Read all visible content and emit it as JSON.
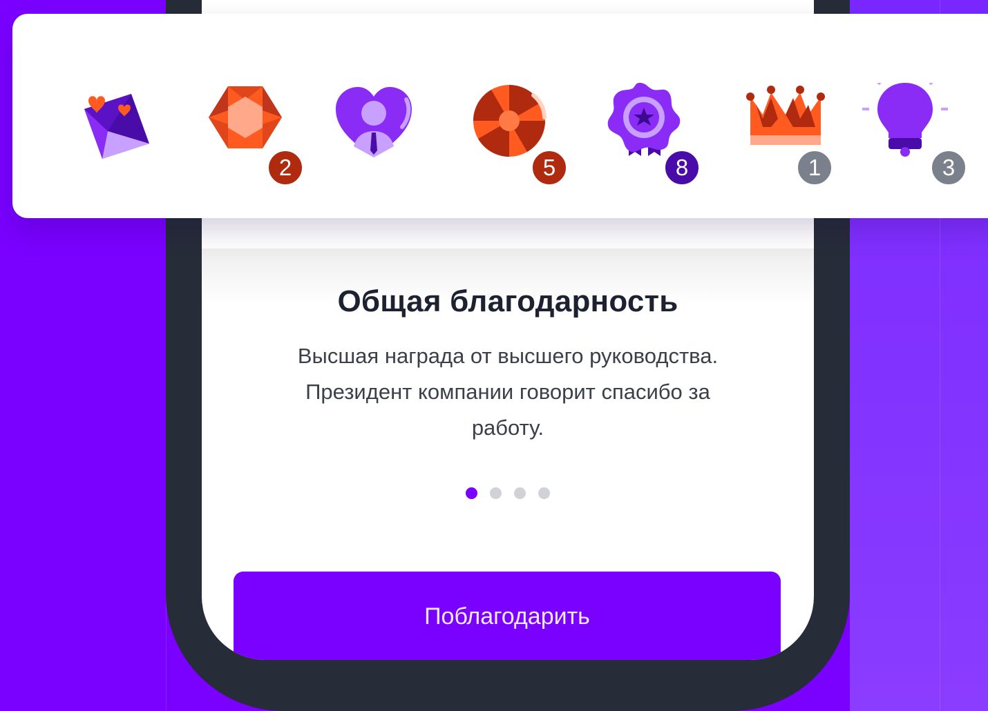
{
  "colors": {
    "brand": "#7a00ff",
    "badge_red": "#b02a10",
    "badge_purple": "#4a0ca8",
    "badge_gray": "#7b818c"
  },
  "awards": [
    {
      "icon": "love-letter-icon",
      "count": ""
    },
    {
      "icon": "gem-icon",
      "count": "2"
    },
    {
      "icon": "heart-person-icon",
      "count": ""
    },
    {
      "icon": "candy-icon",
      "count": "5"
    },
    {
      "icon": "medal-icon",
      "count": "8"
    },
    {
      "icon": "crown-icon",
      "count": "1"
    },
    {
      "icon": "lightbulb-icon",
      "count": "3"
    }
  ],
  "slide": {
    "title": "Общая благодарность",
    "description": "Высшая награда от высшего руководства. Президент компании говорит спасибо за работу."
  },
  "pagination": {
    "total": 4,
    "active": 1
  },
  "cta_label": "Поблагодарить"
}
